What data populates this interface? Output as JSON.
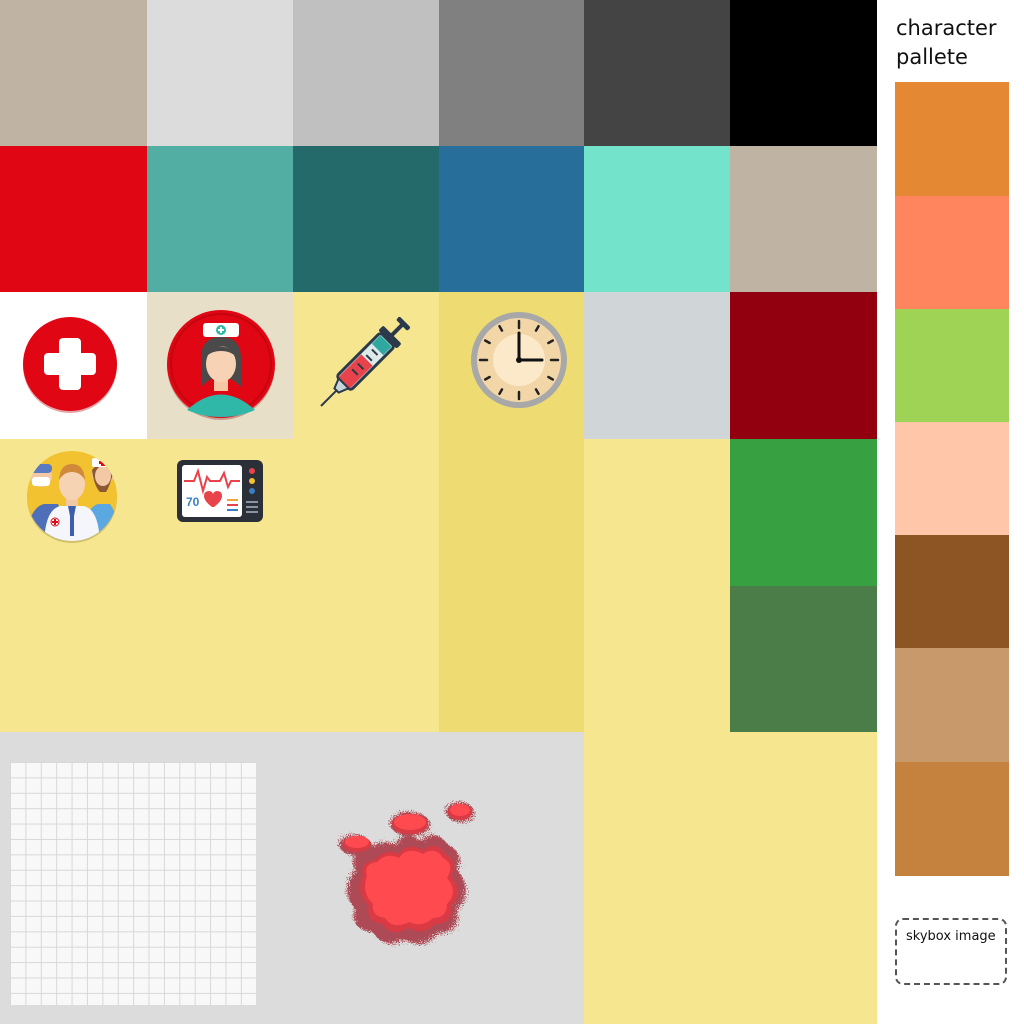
{
  "swatches": {
    "row1": [
      "#bfb3a3",
      "#dcdcdc",
      "#c0c0c0",
      "#808080",
      "#444444",
      "#000000"
    ],
    "row2": [
      "#e10613",
      "#52ada2",
      "#256a6a",
      "#286e9b",
      "#73e3cb",
      "#bfb3a3"
    ],
    "row3_light": "#d0d6d8",
    "row3_darkred": "#920010",
    "green": "#37a040",
    "darkgreen": "#4a7d47",
    "yellow": "#f7e690",
    "yellow_dark": "#eedc73",
    "grey_floor": "#dcdcdc",
    "beige_tile": "#e8dfc8"
  },
  "panel": {
    "title": "character pallete",
    "colors": [
      "#e58834",
      "#ff855e",
      "#9fd355",
      "#ffc6aa",
      "#8e5524",
      "#c8996a",
      "#c5823e"
    ],
    "skybox_label": "skybox image"
  },
  "icons": {
    "clock_number": "",
    "monitor_reading": "70"
  }
}
